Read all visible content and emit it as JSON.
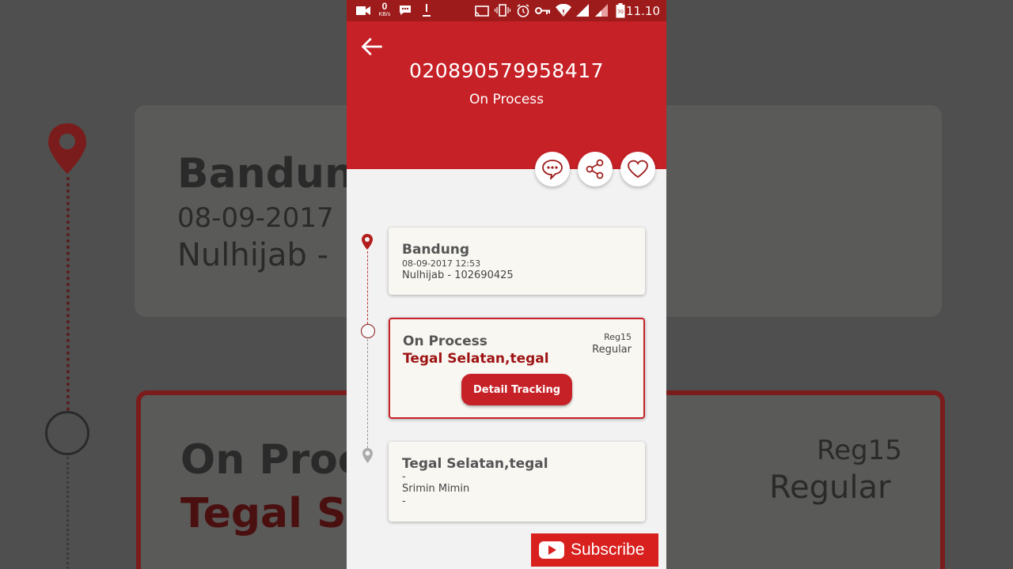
{
  "status_bar": {
    "net_speed": "0",
    "net_unit": "KB/s",
    "time": "11.10"
  },
  "header": {
    "tracking_number": "020890579958417",
    "status": "On Process"
  },
  "actions": {
    "comment_icon": "speech-bubble-icon",
    "share_icon": "share-icon",
    "favorite_icon": "heart-icon"
  },
  "timeline": [
    {
      "title": "Bandung",
      "datetime": "08-09-2017 12:53",
      "person": "Nulhijab - 102690425"
    },
    {
      "status": "On Process",
      "location": "Tegal Selatan,tegal",
      "service_code": "Reg15",
      "service_name": "Regular",
      "button_label": "Detail Tracking"
    },
    {
      "title": "Tegal Selatan,tegal",
      "line1": "-",
      "person": "Srimin Mimin",
      "line3": "-"
    }
  ],
  "background": {
    "card1_title": "Bandun",
    "card1_date": "08-09-2017",
    "card1_person": "Nulhijab -",
    "card2_status": "On Proc",
    "card2_location": "Tegal S",
    "card2_code": "Reg15",
    "card2_service": "Regular"
  },
  "overlay": {
    "subscribe_label": "Subscribe"
  },
  "colors": {
    "brand_red": "#c62127",
    "dark_red": "#9e1b1b"
  }
}
